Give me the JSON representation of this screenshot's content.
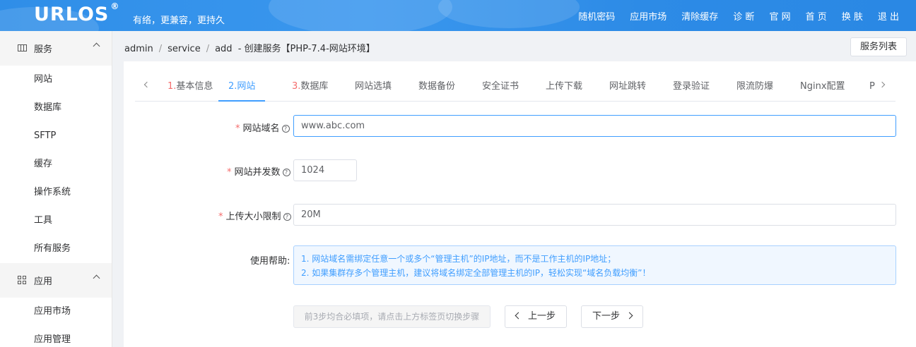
{
  "header": {
    "logo": "URLOS",
    "logo_mark": "®",
    "slogan": "有络，更兼容，更持久",
    "nav": [
      "随机密码",
      "应用市场",
      "清除缓存",
      "诊 断",
      "官 网",
      "首 页",
      "换 肤",
      "退 出"
    ]
  },
  "sidebar": {
    "groups": [
      {
        "label": "服务",
        "icon": "service-icon",
        "items": [
          "网站",
          "数据库",
          "SFTP",
          "缓存",
          "操作系统",
          "工具",
          "所有服务"
        ]
      },
      {
        "label": "应用",
        "icon": "apps-grid-icon",
        "items": [
          "应用市场",
          "应用管理"
        ]
      }
    ]
  },
  "breadcrumb": {
    "items": [
      "admin",
      "service",
      "add"
    ],
    "title": "- 创建服务【PHP-7.4-网站环境】"
  },
  "service_list_button": "服务列表",
  "tabs": [
    {
      "num": "1.",
      "label": "基本信息"
    },
    {
      "num": "2.",
      "label": "网站"
    },
    {
      "num": "3.",
      "label": "数据库"
    },
    {
      "num": "",
      "label": "网站选填"
    },
    {
      "num": "",
      "label": "数据备份"
    },
    {
      "num": "",
      "label": "安全证书"
    },
    {
      "num": "",
      "label": "上传下载"
    },
    {
      "num": "",
      "label": "网址跳转"
    },
    {
      "num": "",
      "label": "登录验证"
    },
    {
      "num": "",
      "label": "限流防爆"
    },
    {
      "num": "",
      "label": "Nginx配置"
    },
    {
      "num": "",
      "label": "P"
    }
  ],
  "form": {
    "domain_label": "网站域名",
    "domain_value": "www.abc.com",
    "concurrency_label": "网站并发数",
    "concurrency_value": "1024",
    "upload_label": "上传大小限制",
    "upload_value": "20M",
    "help_label": "使用帮助:",
    "help_lines": [
      "1. 网站域名需绑定任意一个或多个“管理主机”的IP地址，而不是工作主机的IP地址；",
      "2. 如果集群存多个管理主机，建议将域名绑定全部管理主机的IP，轻松实现“域名负载均衡”！"
    ]
  },
  "buttons": {
    "hint": "前3步均合必填项，请点击上方标签页切换步骤",
    "prev": "上一步",
    "next": "下一步"
  },
  "colors": {
    "primary": "#409eff",
    "required": "#f56c6c",
    "header_bg": "#2f8ee8"
  }
}
